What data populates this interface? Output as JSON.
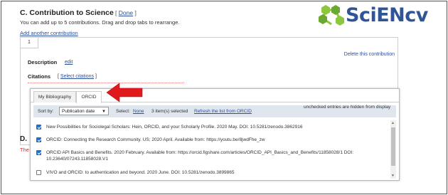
{
  "logo": {
    "text": "SciENcv",
    "icon": "molecule-icon"
  },
  "section": {
    "title": "C. Contribution to Science",
    "done_open": "[",
    "done_label": "Done",
    "done_close": "]",
    "help": "You can add up to 5 contributions. Drag and drop tabs to rearrange.",
    "add_link": "Add another contribution"
  },
  "contribution": {
    "tab_number": "1",
    "delete_link": "Delete this contribution",
    "description_label": "Description",
    "edit_label": "edit",
    "citations_label": "Citations",
    "select_open": "[",
    "select_citations": "Select citations",
    "select_close": "]"
  },
  "dialog": {
    "tabs": [
      {
        "label": "My Bibliography"
      },
      {
        "label": "ORCID"
      }
    ],
    "sort_label": "Sort by:",
    "sort_value": "Publication date",
    "select_label": "Select:",
    "select_none": "None",
    "selected_count": "3 item(s) selected",
    "refresh_link": "Refresh the list from ORCID",
    "hidden_note": "unchecked entries are hidden from display",
    "items": [
      {
        "checked": true,
        "text": "New Possibilities for Sociolegal Scholars: Hein, ORCID, and your Scholarly Profile. 2020 May. DOI: 10.5281/zenodo.3862916"
      },
      {
        "checked": true,
        "text": "ORCID: Connecting the Research Community. US; 2020 April. Available from: https://youtu.be/8jwdFhe_zw"
      },
      {
        "checked": true,
        "text": "ORCID API Basics and Benefits. 2020 February. Available from: https://orcid.figshare.com/articles/ORCID_API_Basics_and_Benefits/11858028/1 DOI: 10.23640/07243.11858028.V1"
      },
      {
        "checked": false,
        "text": "VIVO and ORCID: to authentication and beyond. 2020 June. DOI: 10.5281/zenodo.3899865"
      }
    ]
  },
  "background": {
    "section_d_letter": "D.",
    "red_text": "The"
  },
  "colors": {
    "accent": "#2f5597",
    "link": "#2a4e9a",
    "arrow": "#e0191d",
    "toolbar": "#dfe6ee",
    "checkbox": "#1f6fd1"
  }
}
